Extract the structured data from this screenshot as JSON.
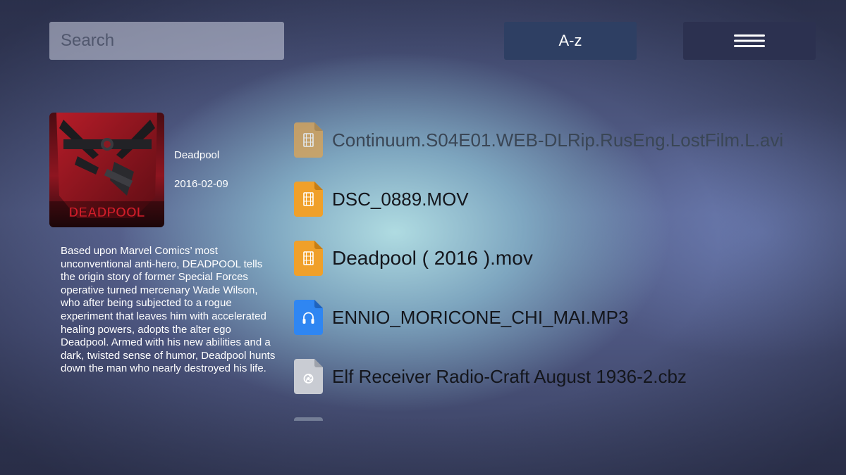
{
  "search": {
    "placeholder": "Search",
    "value": ""
  },
  "toolbar": {
    "sort_label": "A-z",
    "menu_icon": "hamburger-icon"
  },
  "detail": {
    "poster_text": "DEADPOOL",
    "title": "Deadpool",
    "date": "2016-02-09",
    "description": "Based upon Marvel Comics’ most unconventional anti-hero, DEADPOOL tells the origin story of former Special Forces operative turned mercenary Wade Wilson, who after being subjected to a rogue experiment that leaves him with accelerated healing powers, adopts the alter ego Deadpool. Armed with his new abilities and a dark, twisted sense of humor, Deadpool hunts down the man who nearly destroyed his life."
  },
  "files": [
    {
      "name": "Continuum.S04E01.WEB-DLRip.RusEng.LostFilm.L.avi",
      "icon": "video-file-icon",
      "color": "#f0a02a"
    },
    {
      "name": "DSC_0889.MOV",
      "icon": "video-file-icon",
      "color": "#f0a02a"
    },
    {
      "name": "Deadpool ( 2016 ).mov",
      "icon": "video-file-icon",
      "color": "#f0a02a"
    },
    {
      "name": "ENNIO_MORICONE_CHI_MAI.MP3",
      "icon": "audio-file-icon",
      "color": "#2f86f2"
    },
    {
      "name": "Elf Receiver Radio-Craft August 1936-2.cbz",
      "icon": "archive-file-icon",
      "color": "#c9ccd3"
    }
  ],
  "colors": {
    "sort_button": "#2e3f63",
    "menu_button": "#2c3150",
    "video_icon": "#f0a02a",
    "audio_icon": "#2f86f2",
    "archive_icon": "#c9ccd3",
    "poster_red": "#a8161f"
  }
}
